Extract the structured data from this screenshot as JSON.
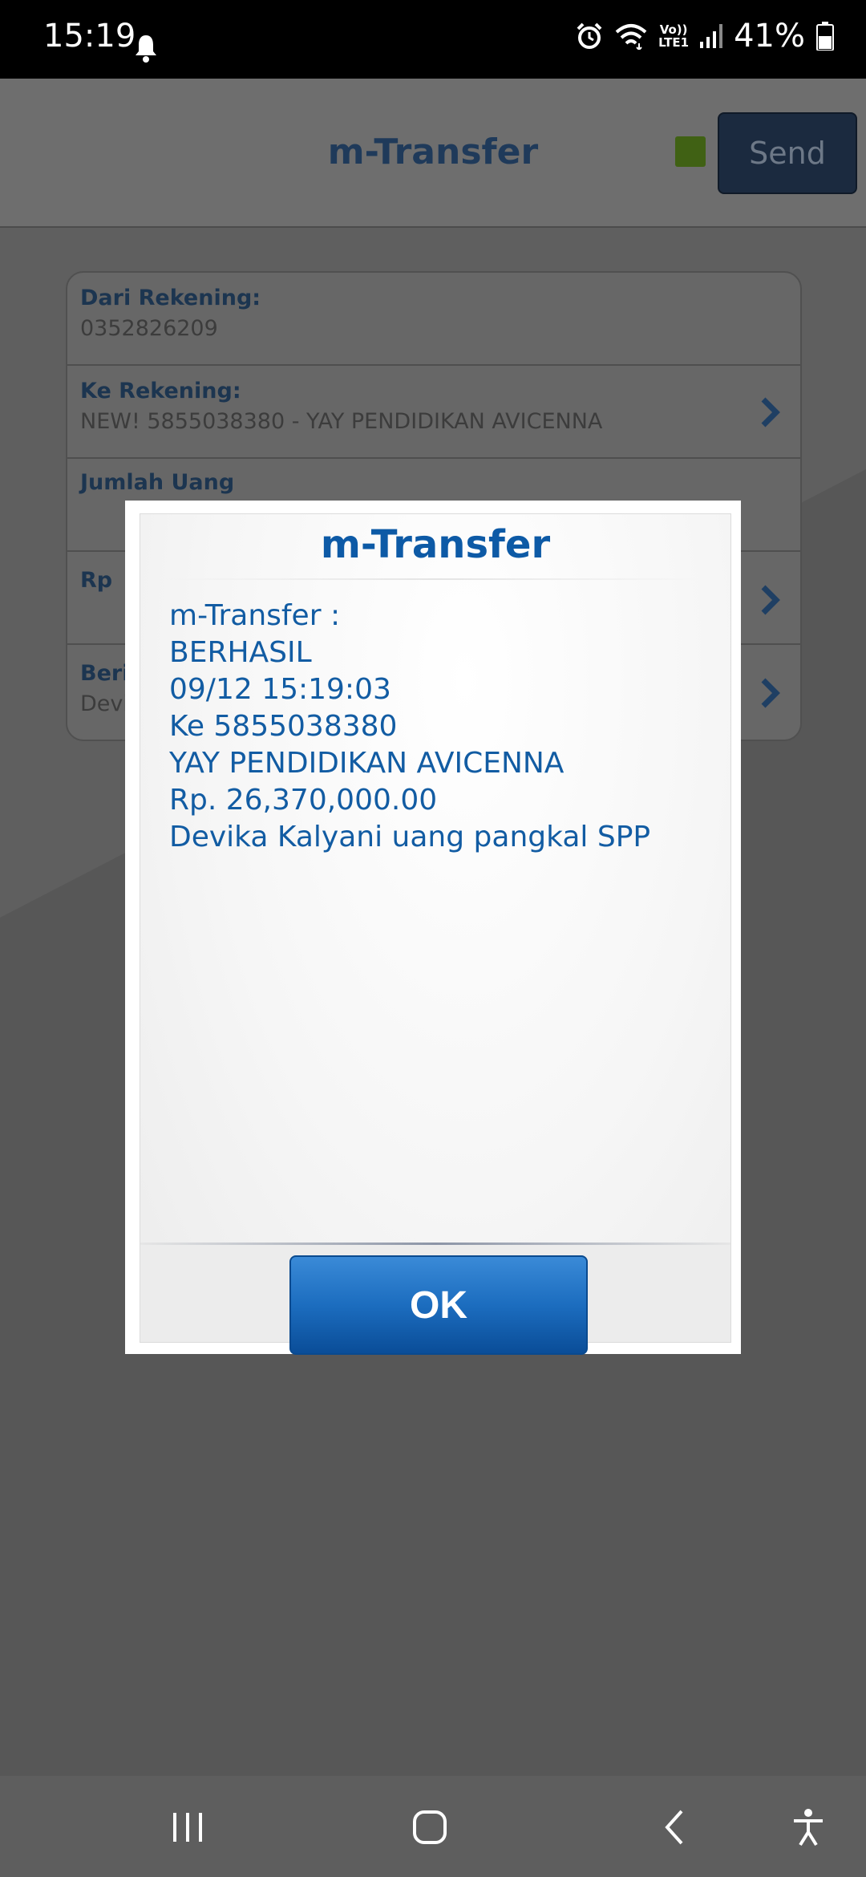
{
  "status_bar": {
    "time": "15:19",
    "battery_percent": "41%",
    "volte_top": "Vo))",
    "volte_bottom": "LTE1",
    "icons": [
      "bell-icon",
      "alarm-icon",
      "wifi-icon",
      "volte-icon",
      "signal-icon",
      "battery-icon"
    ]
  },
  "header": {
    "title": "m-Transfer",
    "send_label": "Send",
    "status_color": "#6aa121"
  },
  "form": {
    "rows": [
      {
        "label": "Dari Rekening:",
        "value": "0352826209"
      },
      {
        "label": "Ke Rekening:",
        "value": "NEW! 5855038380 - YAY PENDIDIKAN AVICENNA"
      },
      {
        "label": "Jumlah Uang",
        "value": ""
      },
      {
        "label": "Rp",
        "value": ""
      },
      {
        "label": "Berit",
        "value": "Devi"
      }
    ]
  },
  "dialog": {
    "title": "m-Transfer",
    "lines": [
      "m-Transfer :",
      "BERHASIL",
      "09/12 15:19:03",
      "Ke 5855038380",
      "YAY PENDIDIKAN AVICENNA",
      "Rp. 26,370,000.00",
      "Devika Kalyani uang pangkal SPP"
    ],
    "ok_label": "OK"
  },
  "colors": {
    "accent_blue": "#0d5aa6",
    "ok_button": "#1c6dbf",
    "status_bar": "#000000"
  },
  "nav_bar": {
    "items": [
      "recent-apps-icon",
      "home-icon",
      "back-icon",
      "accessibility-icon"
    ]
  }
}
